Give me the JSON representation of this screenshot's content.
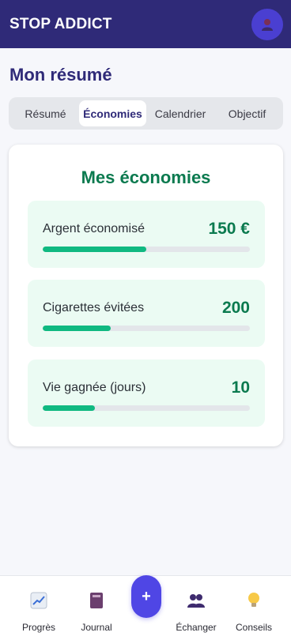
{
  "header": {
    "title": "STOP ADDICT",
    "avatar_icon": "user-icon"
  },
  "page": {
    "title": "Mon résumé"
  },
  "tabs": [
    {
      "label": "Résumé",
      "active": false
    },
    {
      "label": "Économies",
      "active": true
    },
    {
      "label": "Calendrier",
      "active": false
    },
    {
      "label": "Objectif",
      "active": false
    }
  ],
  "savings": {
    "title": "Mes économies",
    "items": [
      {
        "label": "Argent économisé",
        "value": "150 €",
        "progress": 0.5
      },
      {
        "label": "Cigarettes évitées",
        "value": "200",
        "progress": 0.33
      },
      {
        "label": "Vie gagnée (jours)",
        "value": "10",
        "progress": 0.25
      }
    ]
  },
  "bottom_nav": {
    "items": [
      {
        "label": "Progrès",
        "icon": "chart-icon"
      },
      {
        "label": "Journal",
        "icon": "book-icon"
      },
      {
        "label": "Échanger",
        "icon": "people-icon"
      },
      {
        "label": "Conseils",
        "icon": "lightbulb-icon"
      }
    ],
    "fab_label": "+"
  },
  "colors": {
    "header_bg": "#2f2a78",
    "accent_green": "#10b981",
    "value_green": "#0b7a4f",
    "stat_bg": "#ebfbf3",
    "fab": "#4f46e5"
  }
}
